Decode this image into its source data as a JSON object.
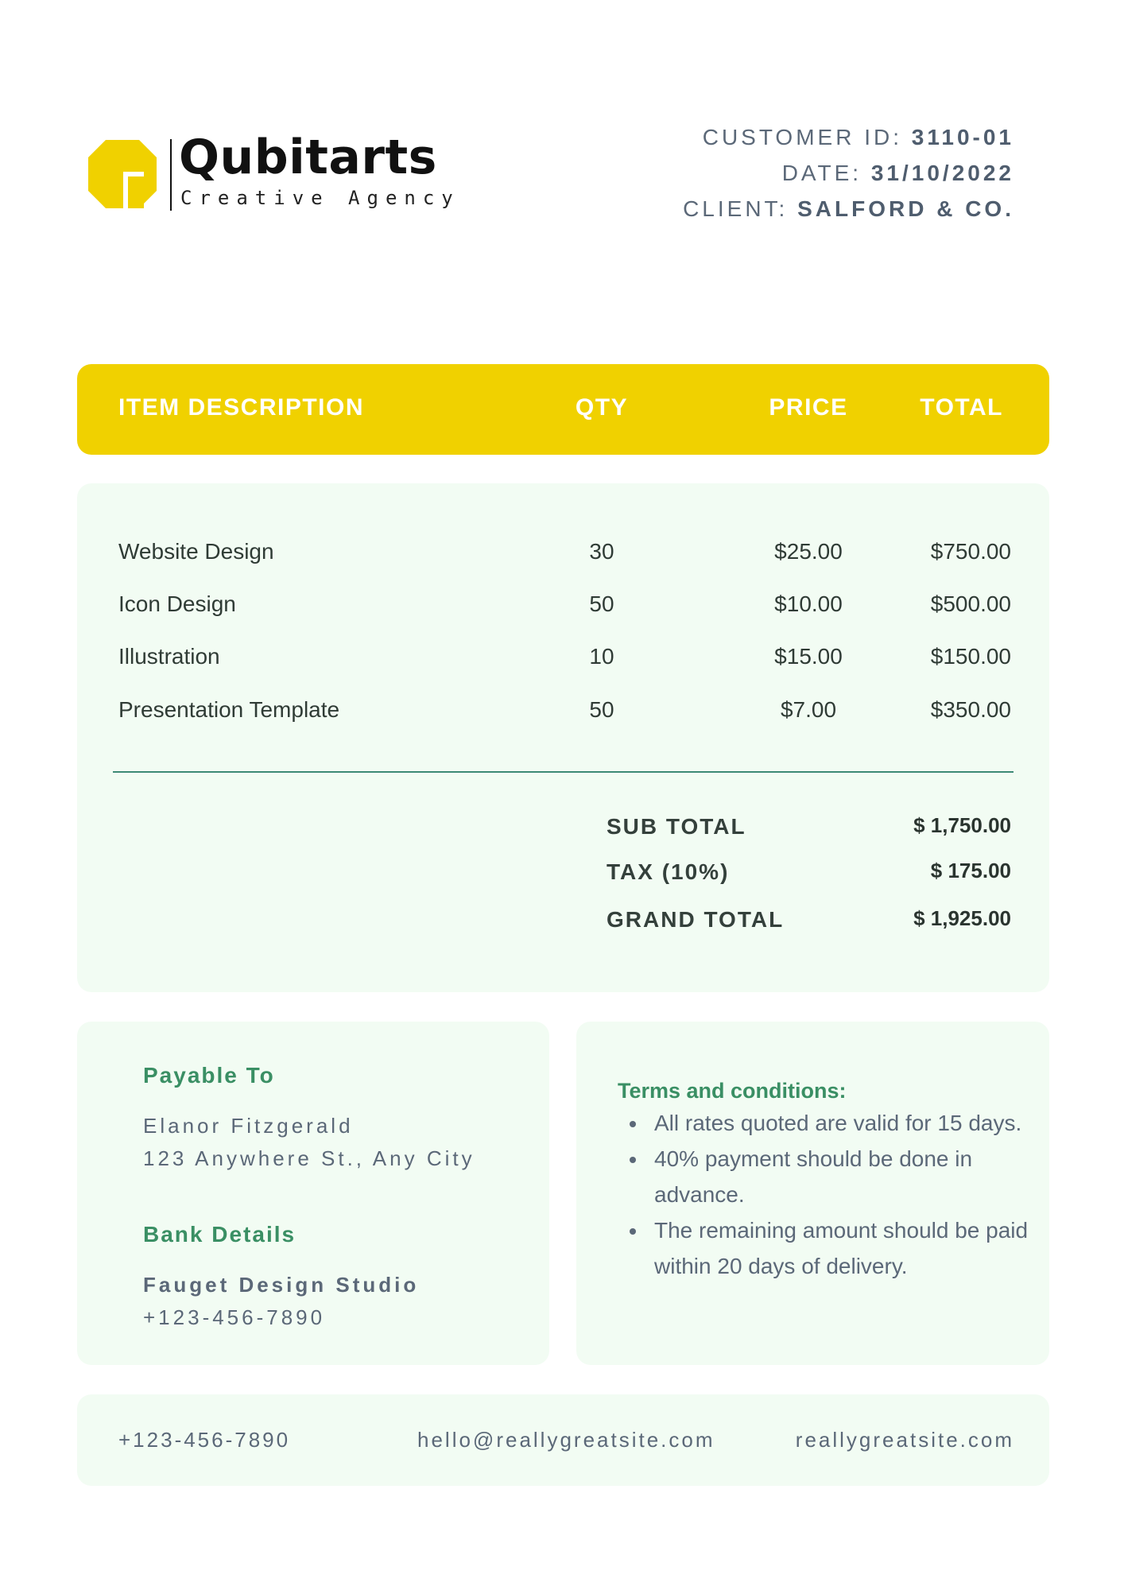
{
  "brand": {
    "name": "Qubitarts",
    "tagline": "Creative Agency",
    "accent_color": "#f0d100"
  },
  "meta": {
    "customer_id_label": "CUSTOMER ID:",
    "customer_id": "3110-01",
    "date_label": "DATE:",
    "date": "31/10/2022",
    "client_label": "CLIENT:",
    "client": "SALFORD & CO."
  },
  "table": {
    "headers": {
      "description": "ITEM DESCRIPTION",
      "qty": "QTY",
      "price": "PRICE",
      "total": "TOTAL"
    },
    "rows": [
      {
        "description": "Website Design",
        "qty": "30",
        "price": "$25.00",
        "total": "$750.00"
      },
      {
        "description": "Icon Design",
        "qty": "50",
        "price": "$10.00",
        "total": "$500.00"
      },
      {
        "description": "Illustration",
        "qty": "10",
        "price": "$15.00",
        "total": "$150.00"
      },
      {
        "description": "Presentation Template",
        "qty": "50",
        "price": "$7.00",
        "total": "$350.00"
      }
    ]
  },
  "summary": {
    "subtotal_label": "SUB TOTAL",
    "subtotal": "$ 1,750.00",
    "tax_label": "TAX (10%)",
    "tax": "$ 175.00",
    "grand_total_label": "GRAND TOTAL",
    "grand_total": "$ 1,925.00"
  },
  "payable": {
    "title": "Payable To",
    "name": "Elanor Fitzgerald",
    "address": "123 Anywhere St., Any City",
    "bank_title": "Bank Details",
    "bank_name": "Fauget Design Studio",
    "bank_phone": "+123-456-7890"
  },
  "terms": {
    "title": "Terms and conditions:",
    "items": [
      "All rates quoted are valid for 15 days.",
      "40% payment should be done in advance.",
      "The remaining amount should be paid within 20 days of delivery."
    ]
  },
  "footer": {
    "phone": "+123-456-7890",
    "email": "hello@reallygreatsite.com",
    "website": "reallygreatsite.com"
  }
}
